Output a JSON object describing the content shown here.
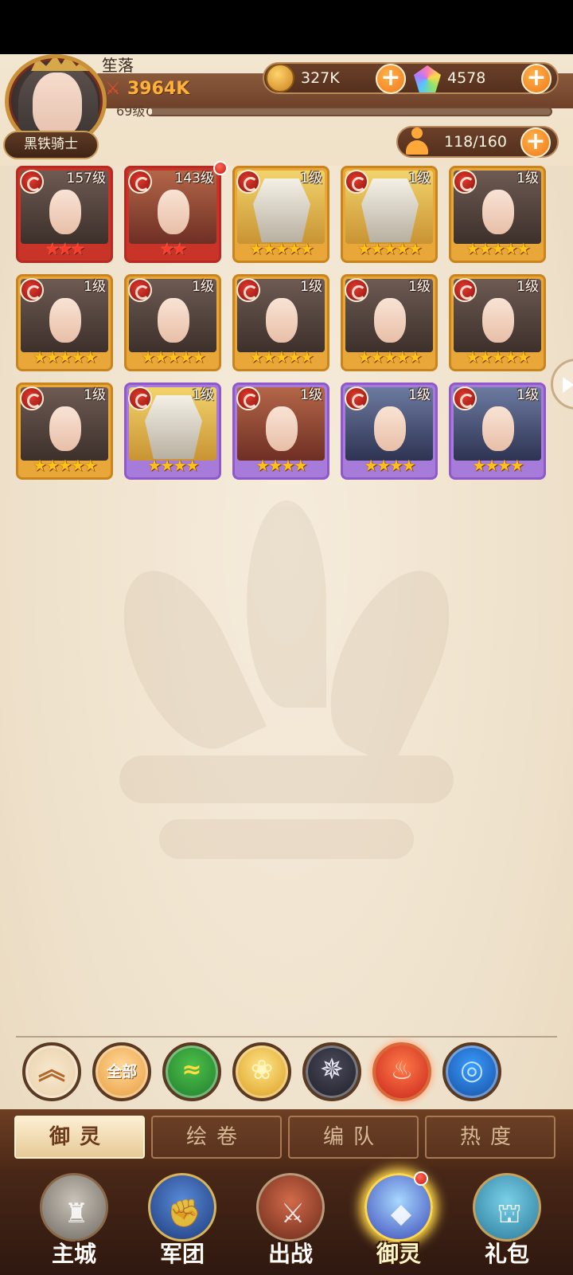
{
  "player": {
    "name": "笙落",
    "title": "黑铁骑士",
    "power": "3964K",
    "level": "69级",
    "exp_fraction": 0.01
  },
  "resources": {
    "coins": "327K",
    "gems": "4578",
    "roster": "118/160"
  },
  "heroes": [
    {
      "level": "157级",
      "stars": 3,
      "rarity": "red",
      "portrait": "dark",
      "badge": false
    },
    {
      "level": "143级",
      "stars": 2,
      "rarity": "red",
      "portrait": "warrior",
      "badge": true
    },
    {
      "level": "1级",
      "stars": 5,
      "rarity": "gold",
      "portrait": "gold",
      "badge": false
    },
    {
      "level": "1级",
      "stars": 5,
      "rarity": "gold",
      "portrait": "gold",
      "badge": false
    },
    {
      "level": "1级",
      "stars": 5,
      "rarity": "gold",
      "portrait": "dark",
      "badge": false
    },
    {
      "level": "1级",
      "stars": 5,
      "rarity": "gold",
      "portrait": "dark",
      "badge": false
    },
    {
      "level": "1级",
      "stars": 5,
      "rarity": "gold",
      "portrait": "dark",
      "badge": false
    },
    {
      "level": "1级",
      "stars": 5,
      "rarity": "gold",
      "portrait": "dark",
      "badge": false
    },
    {
      "level": "1级",
      "stars": 5,
      "rarity": "gold",
      "portrait": "dark",
      "badge": false
    },
    {
      "level": "1级",
      "stars": 5,
      "rarity": "gold",
      "portrait": "dark",
      "badge": false
    },
    {
      "level": "1级",
      "stars": 5,
      "rarity": "gold",
      "portrait": "dark",
      "badge": false
    },
    {
      "level": "1级",
      "stars": 4,
      "rarity": "purple",
      "portrait": "gold",
      "badge": false
    },
    {
      "level": "1级",
      "stars": 4,
      "rarity": "purple",
      "portrait": "warrior",
      "badge": false
    },
    {
      "level": "1级",
      "stars": 4,
      "rarity": "purple",
      "portrait": "scholar",
      "badge": false
    },
    {
      "level": "1级",
      "stars": 4,
      "rarity": "purple",
      "portrait": "scholar",
      "badge": false
    }
  ],
  "filters": [
    {
      "name": "collapse-filter-button",
      "label": "",
      "glyph": "︽",
      "style": "f-up"
    },
    {
      "name": "filter-all-button",
      "label": "全部",
      "glyph": "",
      "style": "f-all"
    },
    {
      "name": "filter-wind-button",
      "label": "",
      "glyph": "≈",
      "style": "f-green"
    },
    {
      "name": "filter-light-button",
      "label": "",
      "glyph": "❀",
      "style": "f-gold"
    },
    {
      "name": "filter-dark-button",
      "label": "",
      "glyph": "✵",
      "style": "f-star"
    },
    {
      "name": "filter-fire-button",
      "label": "",
      "glyph": "♨",
      "style": "f-fire"
    },
    {
      "name": "filter-water-button",
      "label": "",
      "glyph": "◎",
      "style": "f-water"
    }
  ],
  "subtabs": [
    "御灵",
    "绘卷",
    "编队",
    "热度"
  ],
  "nav": [
    {
      "label": "主城",
      "style": "nav-city",
      "glyph": "♜"
    },
    {
      "label": "军团",
      "style": "nav-legion",
      "glyph": "✊"
    },
    {
      "label": "出战",
      "style": "nav-battle",
      "glyph": "⚔"
    },
    {
      "label": "御灵",
      "style": "nav-spirit",
      "glyph": "◆"
    },
    {
      "label": "礼包",
      "style": "nav-gift",
      "glyph": "⛫"
    }
  ],
  "colors": {
    "accent_orange": "#f07a1a",
    "frame_gold": "#c8841e",
    "frame_red": "#b52a22",
    "frame_purple": "#8f5ac8"
  }
}
